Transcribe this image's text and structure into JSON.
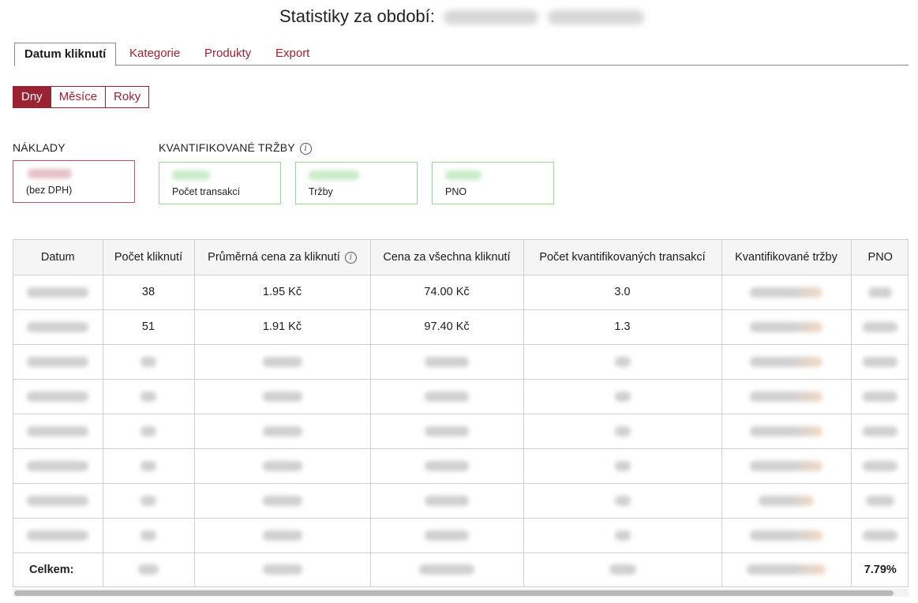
{
  "header": {
    "title": "Statistiky za období:"
  },
  "tabs": [
    {
      "label": "Datum kliknutí",
      "active": true
    },
    {
      "label": "Kategorie",
      "active": false
    },
    {
      "label": "Produkty",
      "active": false
    },
    {
      "label": "Export",
      "active": false
    }
  ],
  "period_buttons": [
    {
      "label": "Dny",
      "active": true
    },
    {
      "label": "Měsíce",
      "active": false
    },
    {
      "label": "Roky",
      "active": false
    }
  ],
  "costs": {
    "heading": "NÁKLADY",
    "caption": "(bez DPH)"
  },
  "revenue": {
    "heading": "KVANTIFIKOVANÉ TRŽBY",
    "boxes": [
      {
        "caption": "Počet transakcí"
      },
      {
        "caption": "Tržby"
      },
      {
        "caption": "PNO"
      }
    ]
  },
  "table": {
    "columns": [
      "Datum",
      "Počet kliknutí",
      "Průměrná cena za kliknutí",
      "Cena za všechna kliknutí",
      "Počet kvantifikovaných transakcí",
      "Kvantifikované tržby",
      "PNO"
    ],
    "rows": [
      {
        "clicks": "38",
        "avg_cpc": "1.95 Kč",
        "total_cost": "74.00 Kč",
        "transactions": "3.0"
      },
      {
        "clicks": "51",
        "avg_cpc": "1.91 Kč",
        "total_cost": "97.40 Kč",
        "transactions": "1.3"
      }
    ],
    "footer": {
      "label": "Celkem:",
      "pno": "7.79%"
    }
  },
  "colors": {
    "accent": "#9b2232",
    "cost_border": "#b5556a",
    "revenue_border": "#9fd49f"
  }
}
